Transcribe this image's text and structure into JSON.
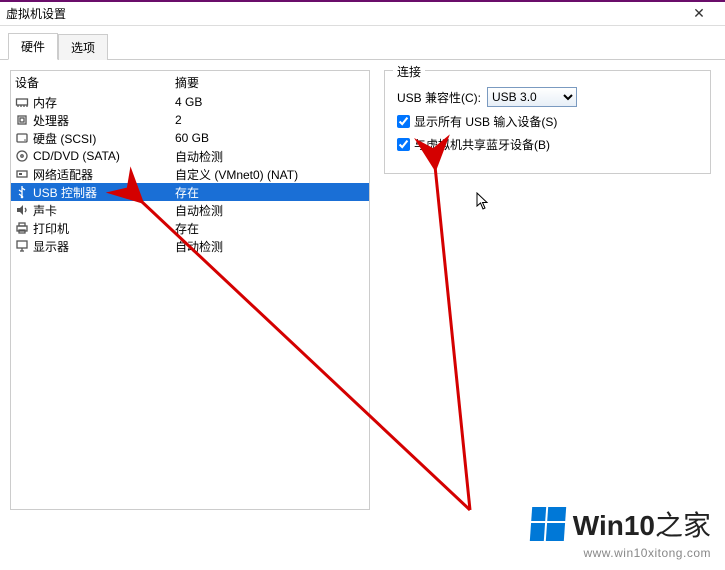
{
  "window": {
    "title": "虚拟机设置",
    "close_glyph": "✕"
  },
  "tabs": {
    "hardware": "硬件",
    "options": "选项"
  },
  "columns": {
    "device": "设备",
    "summary": "摘要"
  },
  "devices": [
    {
      "icon": "memory-icon",
      "label": "内存",
      "summary": "4 GB"
    },
    {
      "icon": "cpu-icon",
      "label": "处理器",
      "summary": "2"
    },
    {
      "icon": "disk-icon",
      "label": "硬盘 (SCSI)",
      "summary": "60 GB"
    },
    {
      "icon": "cd-icon",
      "label": "CD/DVD (SATA)",
      "summary": "自动检测"
    },
    {
      "icon": "network-icon",
      "label": "网络适配器",
      "summary": "自定义 (VMnet0) (NAT)"
    },
    {
      "icon": "usb-icon",
      "label": "USB 控制器",
      "summary": "存在"
    },
    {
      "icon": "sound-icon",
      "label": "声卡",
      "summary": "自动检测"
    },
    {
      "icon": "printer-icon",
      "label": "打印机",
      "summary": "存在"
    },
    {
      "icon": "display-icon",
      "label": "显示器",
      "summary": "自动检测"
    }
  ],
  "selected_index": 5,
  "connection": {
    "legend": "连接",
    "compat_label": "USB 兼容性(C):",
    "compat_value": "USB 3.0",
    "show_all_label": "显示所有 USB 输入设备(S)",
    "show_all_checked": true,
    "share_bt_label": "与虚拟机共享蓝牙设备(B)",
    "share_bt_checked": true
  },
  "watermark": {
    "brand_main": "Win10",
    "brand_suffix": "之家",
    "url": "www.win10xitong.com"
  }
}
